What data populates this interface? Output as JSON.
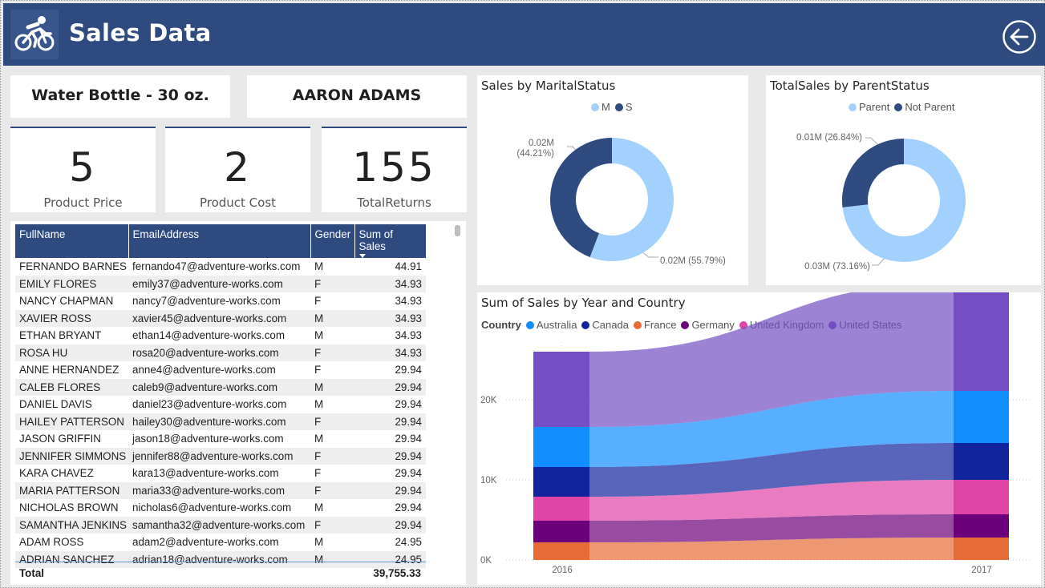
{
  "header": {
    "title": "Sales Data",
    "logo_icon": "cyclist-icon",
    "back_icon": "back-arrow-icon",
    "color": "#2e4a7f"
  },
  "slicers": {
    "product": "Water Bottle - 30 oz.",
    "customer": "AARON ADAMS"
  },
  "kpis": [
    {
      "value": "5",
      "label": "Product Price"
    },
    {
      "value": "2",
      "label": "Product Cost"
    },
    {
      "value": "155",
      "label": "TotalReturns"
    }
  ],
  "table": {
    "columns": [
      "FullName",
      "EmailAddress",
      "Gender",
      "Sum of Sales"
    ],
    "rows": [
      [
        "FERNANDO BARNES",
        "fernando47@adventure-works.com",
        "M",
        "44.91"
      ],
      [
        "EMILY FLORES",
        "emily37@adventure-works.com",
        "F",
        "34.93"
      ],
      [
        "NANCY CHAPMAN",
        "nancy7@adventure-works.com",
        "F",
        "34.93"
      ],
      [
        "XAVIER ROSS",
        "xavier45@adventure-works.com",
        "M",
        "34.93"
      ],
      [
        "ETHAN BRYANT",
        "ethan14@adventure-works.com",
        "M",
        "34.93"
      ],
      [
        "ROSA HU",
        "rosa20@adventure-works.com",
        "F",
        "34.93"
      ],
      [
        "ANNE HERNANDEZ",
        "anne4@adventure-works.com",
        "F",
        "29.94"
      ],
      [
        "CALEB FLORES",
        "caleb9@adventure-works.com",
        "M",
        "29.94"
      ],
      [
        "DANIEL DAVIS",
        "daniel23@adventure-works.com",
        "M",
        "29.94"
      ],
      [
        "HAILEY PATTERSON",
        "hailey30@adventure-works.com",
        "F",
        "29.94"
      ],
      [
        "JASON GRIFFIN",
        "jason18@adventure-works.com",
        "M",
        "29.94"
      ],
      [
        "JENNIFER SIMMONS",
        "jennifer88@adventure-works.com",
        "F",
        "29.94"
      ],
      [
        "KARA CHAVEZ",
        "kara13@adventure-works.com",
        "F",
        "29.94"
      ],
      [
        "MARIA PATTERSON",
        "maria33@adventure-works.com",
        "F",
        "29.94"
      ],
      [
        "NICHOLAS BROWN",
        "nicholas6@adventure-works.com",
        "M",
        "29.94"
      ],
      [
        "SAMANTHA JENKINS",
        "samantha32@adventure-works.com",
        "F",
        "29.94"
      ],
      [
        "ADAM ROSS",
        "adam2@adventure-works.com",
        "M",
        "24.95"
      ],
      [
        "ADRIAN SANCHEZ",
        "adrian18@adventure-works.com",
        "M",
        "24.95"
      ]
    ],
    "total_label": "Total",
    "total_value": "39,755.33"
  },
  "chart_data": [
    {
      "type": "pie",
      "title": "Sales by MaritalStatus",
      "donut": true,
      "legend_position": "top-center",
      "slices": [
        {
          "name": "M",
          "value": 0.02,
          "percent": 55.79,
          "label": "0.02M (55.79%)",
          "color": "#a3d1ff"
        },
        {
          "name": "S",
          "value": 0.02,
          "percent": 44.21,
          "label": "0.02M (44.21%)",
          "color": "#2e4a7f"
        }
      ]
    },
    {
      "type": "pie",
      "title": "TotalSales by ParentStatus",
      "donut": true,
      "legend_position": "top-center",
      "slices": [
        {
          "name": "Parent",
          "value": 0.03,
          "percent": 73.16,
          "label": "0.03M (73.16%)",
          "color": "#a3d1ff"
        },
        {
          "name": "Not Parent",
          "value": 0.01,
          "percent": 26.84,
          "label": "0.01M (26.84%)",
          "color": "#2e4a7f"
        }
      ]
    },
    {
      "type": "bar",
      "subtype": "stacked ribbon",
      "title": "Sum of Sales by Year and Country",
      "legend_title": "Country",
      "legend_position": "top-left",
      "categories": [
        "2016",
        "2017"
      ],
      "yticks": [
        "0K",
        "10K",
        "20K"
      ],
      "ylim": [
        0,
        25000
      ],
      "grid": true,
      "series": [
        {
          "name": "Australia",
          "color": "#118dff",
          "values": [
            5000,
            6500
          ]
        },
        {
          "name": "Canada",
          "color": "#12239e",
          "values": [
            3700,
            4600
          ]
        },
        {
          "name": "France",
          "color": "#e66c37",
          "values": [
            2200,
            2800
          ]
        },
        {
          "name": "Germany",
          "color": "#6b007b",
          "values": [
            2700,
            2900
          ]
        },
        {
          "name": "United Kingdom",
          "color": "#e044a7",
          "values": [
            3000,
            4300
          ]
        },
        {
          "name": "United States",
          "color": "#744ec2",
          "values": [
            9400,
            13500
          ]
        }
      ],
      "stack_order": [
        "France",
        "Germany",
        "United Kingdom",
        "Canada",
        "Australia",
        "United States"
      ]
    }
  ]
}
